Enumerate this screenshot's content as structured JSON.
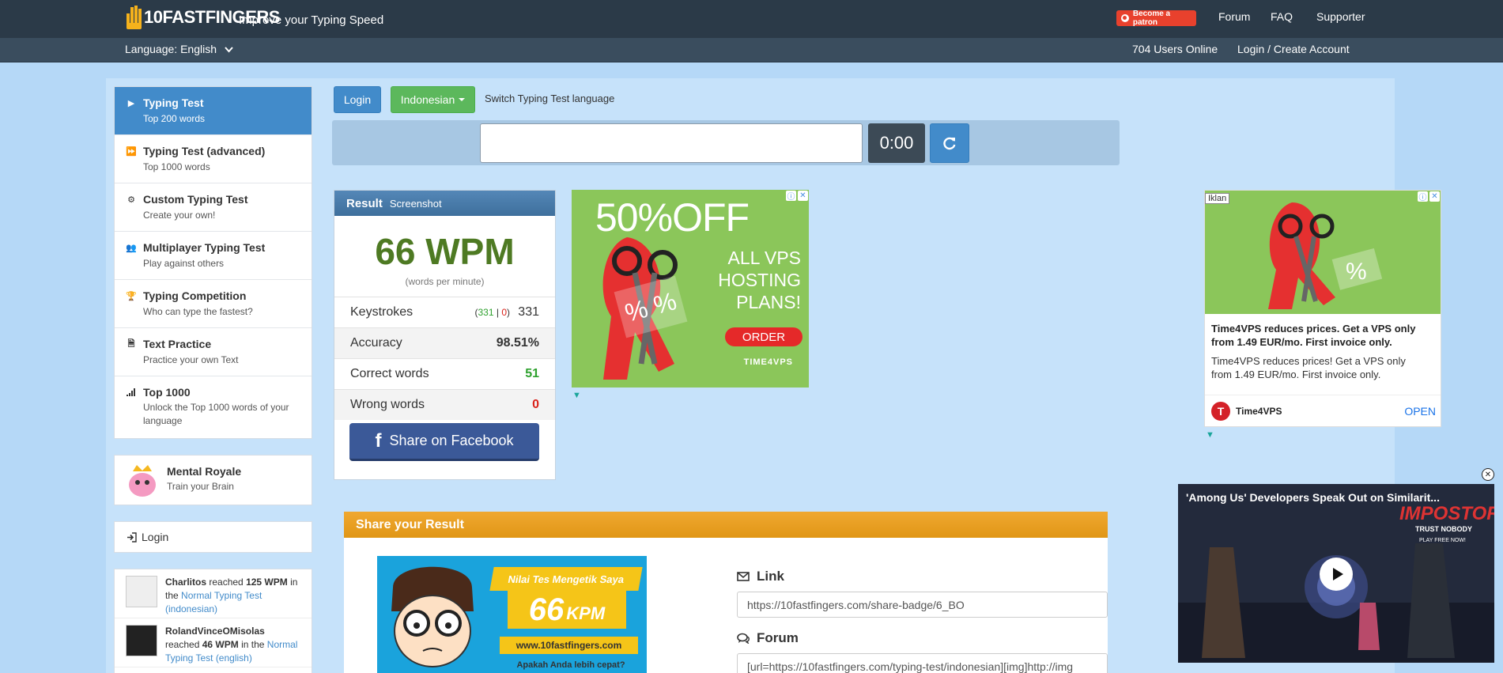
{
  "header": {
    "brand": "10FASTFINGERS",
    "tagline": "Improve your Typing Speed",
    "patron_label": "Become a patron",
    "nav": [
      "Forum",
      "FAQ",
      "Supporter"
    ],
    "language_label": "Language: English",
    "users_online": "704 Users Online",
    "login_create": "Login / Create Account"
  },
  "sidebar": {
    "items": [
      {
        "title": "Typing Test",
        "sub": "Top 200 words",
        "icon": "play-icon"
      },
      {
        "title": "Typing Test (advanced)",
        "sub": "Top 1000 words",
        "icon": "fast-forward-icon"
      },
      {
        "title": "Custom Typing Test",
        "sub": "Create your own!",
        "icon": "cogs-icon"
      },
      {
        "title": "Multiplayer Typing Test",
        "sub": "Play against others",
        "icon": "users-icon"
      },
      {
        "title": "Typing Competition",
        "sub": "Who can type the fastest?",
        "icon": "trophy-icon"
      },
      {
        "title": "Text Practice",
        "sub": "Practice your own Text",
        "icon": "document-icon"
      },
      {
        "title": "Top 1000",
        "sub": "Unlock the Top 1000 words of your language",
        "icon": "signal-icon"
      }
    ],
    "mental": {
      "title": "Mental Royale",
      "sub": "Train your Brain"
    },
    "login_label": "Login",
    "activity": [
      {
        "user": "Charlitos",
        "verb": "reached",
        "wpm": "125 WPM",
        "in": "in the",
        "test": "Normal Typing Test (indonesian)"
      },
      {
        "user": "RolandVinceOMisolas",
        "verb": "reached",
        "wpm": "46 WPM",
        "in": "in the",
        "test": "Normal Typing Test (english)"
      }
    ]
  },
  "controls": {
    "login_button": "Login",
    "language_button": "Indonesian",
    "switch_label": "Switch Typing Test language",
    "timer": "0:00"
  },
  "result": {
    "heading": "Result",
    "screenshot_label": "Screenshot",
    "wpm": "66 WPM",
    "wpm_sub": "(words per minute)",
    "stats": [
      {
        "label": "Keystrokes",
        "value": "331"
      },
      {
        "label": "Accuracy",
        "value": "98.51%"
      },
      {
        "label": "Correct words",
        "value": "51"
      },
      {
        "label": "Wrong words",
        "value": "0"
      }
    ],
    "keystrokes_correct": "331",
    "keystrokes_sep": "|",
    "keystrokes_wrong": "0",
    "facebook_label": "Share on Facebook"
  },
  "ad1": {
    "headline": "50%OFF",
    "lines": [
      "ALL VPS",
      "HOSTING",
      "PLANS!"
    ],
    "cta": "ORDER",
    "brand": "TIME4VPS"
  },
  "ad2": {
    "tag": "Iklan",
    "title": "Time4VPS reduces prices. Get a VPS only from 1.49 EUR/mo. First invoice only.",
    "desc": "Time4VPS reduces prices! Get a VPS only from 1.49 EUR/mo. First invoice only.",
    "brand": "Time4VPS",
    "open": "OPEN"
  },
  "share": {
    "heading": "Share your Result",
    "badge_title": "Nilai Tes Mengetik Saya",
    "badge_score": "66",
    "badge_unit": "KPM",
    "badge_site": "www.10fastfingers.com",
    "badge_question": "Apakah Anda lebih cepat?",
    "link_label": "Link",
    "link_value": "https://10fastfingers.com/share-badge/6_BO",
    "forum_label": "Forum",
    "forum_value": "[url=https://10fastfingers.com/typing-test/indonesian][img]http://img"
  },
  "video": {
    "title": "'Among Us' Developers Speak Out on Similarit...",
    "bg_text": "IMPOSTORS",
    "bg_sub": "TRUST NOBODY",
    "bg_cta": "PLAY FREE NOW!"
  },
  "colors": {
    "header_bg": "#2b3a48",
    "primary": "#428bca",
    "success": "#5cb85c",
    "wpm": "#4e7a23",
    "share_head": "#f0a830"
  }
}
